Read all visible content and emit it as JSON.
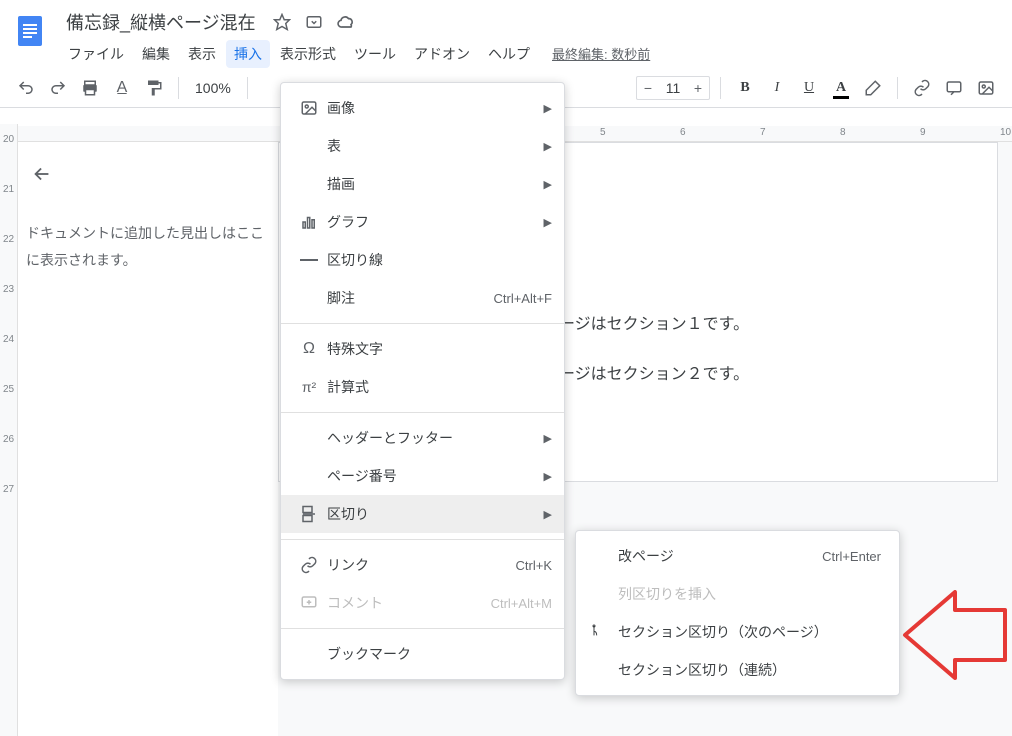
{
  "doc_title": "備忘録_縦横ページ混在",
  "last_edit": "最終編集: 数秒前",
  "menubar": {
    "file": "ファイル",
    "edit": "編集",
    "view": "表示",
    "insert": "挿入",
    "format": "表示形式",
    "tools": "ツール",
    "addons": "アドオン",
    "help": "ヘルプ"
  },
  "toolbar": {
    "zoom": "100%",
    "font_size": "11"
  },
  "outline": {
    "text": "ドキュメントに追加した見出しはここに表示されます。"
  },
  "doc_content": {
    "line1": "ージはセクション１です。",
    "line2": "ージはセクション２です。"
  },
  "ruler_h": [
    "5",
    "6",
    "7",
    "8",
    "9",
    "10"
  ],
  "ruler_v": [
    "20",
    "21",
    "22",
    "23",
    "24",
    "25",
    "26",
    "27"
  ],
  "menu": {
    "image": "画像",
    "table": "表",
    "drawing": "描画",
    "chart": "グラフ",
    "hr": "区切り線",
    "footnote": "脚注",
    "footnote_short": "Ctrl+Alt+F",
    "special": "特殊文字",
    "equation": "計算式",
    "header_footer": "ヘッダーとフッター",
    "page_number": "ページ番号",
    "break": "区切り",
    "link": "リンク",
    "link_short": "Ctrl+K",
    "comment": "コメント",
    "comment_short": "Ctrl+Alt+M",
    "bookmark": "ブックマーク"
  },
  "submenu": {
    "page_break": "改ページ",
    "page_break_short": "Ctrl+Enter",
    "column_break": "列区切りを挿入",
    "section_next": "セクション区切り（次のページ）",
    "section_cont": "セクション区切り（連続）"
  }
}
